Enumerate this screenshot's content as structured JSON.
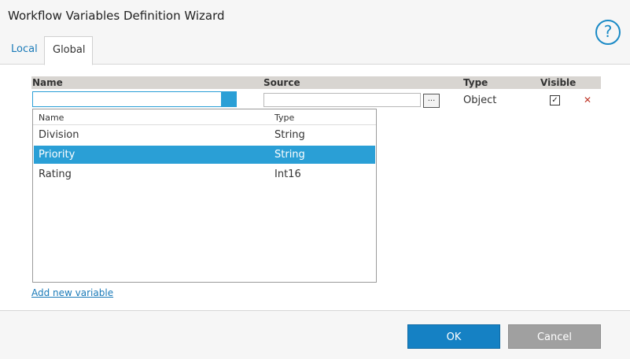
{
  "window": {
    "title": "Workflow Variables Definition Wizard",
    "help_glyph": "?"
  },
  "tabs": [
    {
      "label": "Local",
      "active": false
    },
    {
      "label": "Global",
      "active": true
    }
  ],
  "grid": {
    "columns": {
      "name": "Name",
      "source": "Source",
      "type": "Type",
      "visible": "Visible"
    },
    "row": {
      "name_value": "",
      "source_value": "",
      "browse_label": "...",
      "type": "Object",
      "visible_mark": "✓",
      "delete_glyph": "✕"
    }
  },
  "dropdown": {
    "columns": {
      "name": "Name",
      "type": "Type"
    },
    "items": [
      {
        "name": "Division",
        "type": "String"
      },
      {
        "name": "Priority",
        "type": "String",
        "selected": true
      },
      {
        "name": "Rating",
        "type": "Int16"
      }
    ]
  },
  "add_variable_label": "Add new variable",
  "buttons": {
    "ok": "OK",
    "cancel": "Cancel"
  },
  "colors": {
    "accent": "#2a9fd6",
    "primary_button": "#1581c4",
    "secondary_button": "#a0a0a0",
    "link": "#1a7ab8"
  },
  "icons": {
    "help": "help-icon",
    "delete": "delete-icon",
    "checkbox": "checkbox-icon",
    "dropdown": "dropdown-icon"
  }
}
